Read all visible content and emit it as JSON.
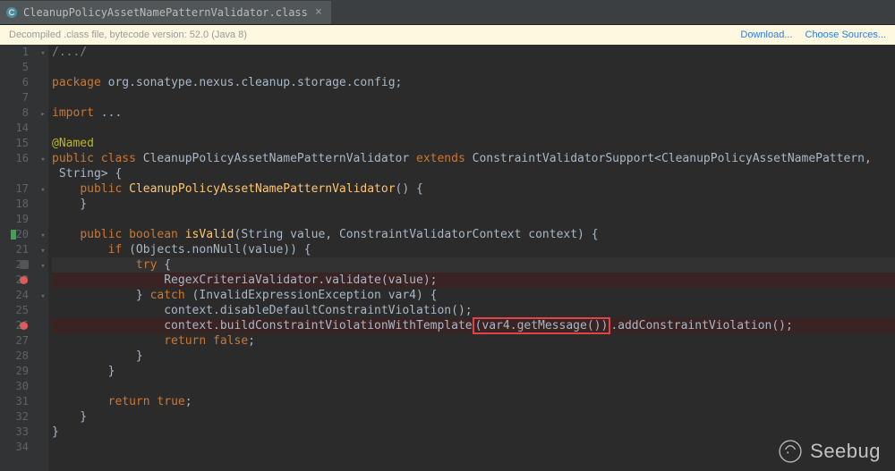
{
  "tab": {
    "label": "CleanupPolicyAssetNamePatternValidator.class"
  },
  "banner": {
    "text": "Decompiled .class file, bytecode version: 52.0 (Java 8)",
    "download": "Download...",
    "chooseSources": "Choose Sources..."
  },
  "watermark": {
    "label": "Seebug"
  },
  "lines": [
    {
      "n": 1,
      "fold": "box",
      "html": "<span class='c-cmt'>/.../</span>"
    },
    {
      "n": 5,
      "html": ""
    },
    {
      "n": 6,
      "html": "<span class='c-kw'>package</span> <span class='c-pkg'>org.sonatype.nexus.cleanup.storage.config;</span>"
    },
    {
      "n": 7,
      "html": ""
    },
    {
      "n": 8,
      "fold": "pls",
      "html": "<span class='c-kw'>import</span> <span class='c-pkg'>...</span>"
    },
    {
      "n": 14,
      "html": ""
    },
    {
      "n": 15,
      "html": "<span class='c-ann'>@Named</span>"
    },
    {
      "n": 16,
      "fold": "box",
      "wrap": true,
      "seg1": "<span class='c-kw'>public class</span> <span class='c-typ'>CleanupPolicyAssetNamePatternValidator</span> <span class='c-kw'>extends</span> <span class='c-typ'>ConstraintValidatorSupport</span>&lt;<span class='c-typ'>CleanupPolicyAssetNamePattern</span>,",
      "seg2": " <span class='c-typ'>String</span>&gt; {"
    },
    {
      "n": 17,
      "fold": "box",
      "html": "    <span class='c-kw'>public</span> <span class='c-fn'>CleanupPolicyAssetNamePatternValidator</span>() {"
    },
    {
      "n": 18,
      "fold": "",
      "html": "    }"
    },
    {
      "n": 19,
      "html": ""
    },
    {
      "n": 20,
      "fold": "box",
      "mark": "grn",
      "html": "    <span class='c-kw'>public boolean</span> <span class='c-fn'>isValid</span>(<span class='c-typ'>String</span> value, <span class='c-typ'>ConstraintValidatorContext</span> context) {"
    },
    {
      "n": 21,
      "fold": "box",
      "html": "        <span class='c-kw'>if</span> (Objects.nonNull(value)) {"
    },
    {
      "n": 22,
      "fold": "box",
      "hl": true,
      "mark": "shield",
      "html": "            <span class='c-kw'>try</span> {"
    },
    {
      "n": 23,
      "bp": true,
      "html": "                RegexCriteriaValidator.validate(value);"
    },
    {
      "n": 24,
      "fold": "box",
      "html": "            } <span class='c-kw'>catch</span> (<span class='c-typ'>InvalidExpressionException</span> var4) {"
    },
    {
      "n": 25,
      "html": "                context.disableDefaultConstraintViolation();"
    },
    {
      "n": 26,
      "bp": true,
      "html": "                context.buildConstraintViolationWithTemplate<span class='redbox'>(var4.getMessage())</span>.addConstraintViolation();"
    },
    {
      "n": 27,
      "html": "                <span class='c-kw'>return false</span>;"
    },
    {
      "n": 28,
      "fold": "",
      "html": "            }"
    },
    {
      "n": 29,
      "fold": "",
      "html": "        }"
    },
    {
      "n": 30,
      "html": ""
    },
    {
      "n": 31,
      "html": "        <span class='c-kw'>return true</span>;"
    },
    {
      "n": 32,
      "fold": "",
      "html": "    }"
    },
    {
      "n": 33,
      "fold": "",
      "html": "}"
    },
    {
      "n": 34,
      "html": ""
    }
  ]
}
